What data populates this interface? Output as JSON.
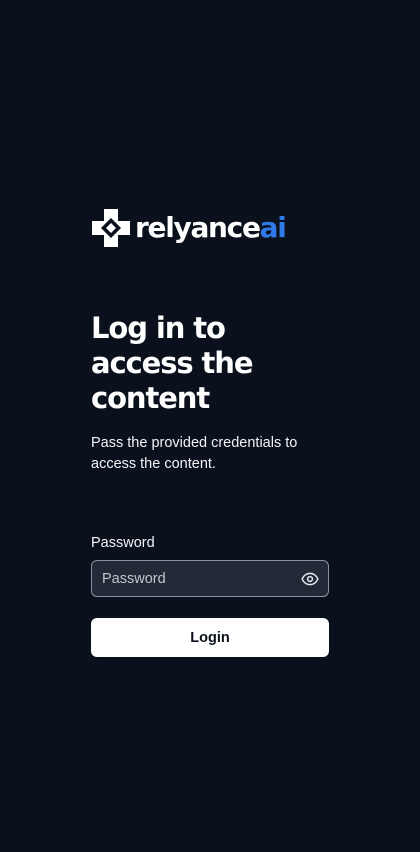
{
  "brand": {
    "name_main": "relyance",
    "name_accent": "ai",
    "accent_color": "#2f7ae8",
    "mark_icon": "relyance-logo-icon"
  },
  "heading": {
    "title": "Log in to access the content",
    "subtitle": "Pass the provided credentials to access the content."
  },
  "form": {
    "password_label": "Password",
    "password_placeholder": "Password",
    "password_value": "",
    "visibility_icon": "eye-icon",
    "login_label": "Login"
  },
  "colors": {
    "background": "#0b111c",
    "input_background": "#232a37",
    "input_border": "#8a93a3",
    "button_background": "#ffffff",
    "button_text": "#0b111c"
  }
}
